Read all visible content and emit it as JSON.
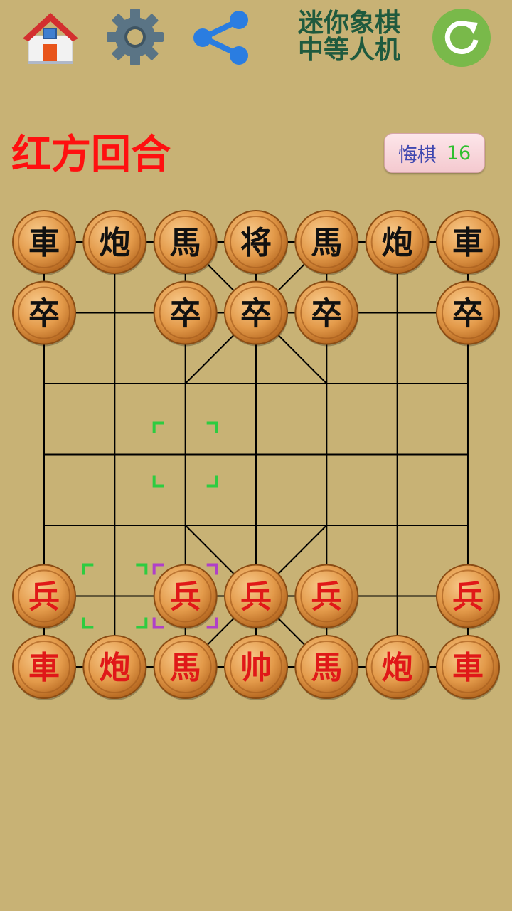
{
  "header": {
    "title_line1": "迷你象棋",
    "title_line2": "中等人机",
    "icons": {
      "home": "home-icon",
      "settings": "gear-icon",
      "share": "share-icon",
      "refresh": "refresh-icon"
    }
  },
  "status": {
    "turn_text": "红方回合"
  },
  "undo": {
    "label": "悔棋",
    "count": "16"
  },
  "board": {
    "columns": 7,
    "rows": 7,
    "colors": {
      "line": "#000000",
      "black_piece_text": "#111111",
      "red_piece_text": "#e01818",
      "piece_fill": "#e9a65a",
      "select_green": "#2ecc40",
      "select_purple": "#b040c8"
    },
    "pieces": [
      {
        "col": 0,
        "row": 0,
        "side": "black",
        "char": "車"
      },
      {
        "col": 1,
        "row": 0,
        "side": "black",
        "char": "炮"
      },
      {
        "col": 2,
        "row": 0,
        "side": "black",
        "char": "馬"
      },
      {
        "col": 3,
        "row": 0,
        "side": "black",
        "char": "将"
      },
      {
        "col": 4,
        "row": 0,
        "side": "black",
        "char": "馬"
      },
      {
        "col": 5,
        "row": 0,
        "side": "black",
        "char": "炮"
      },
      {
        "col": 6,
        "row": 0,
        "side": "black",
        "char": "車"
      },
      {
        "col": 0,
        "row": 1,
        "side": "black",
        "char": "卒"
      },
      {
        "col": 2,
        "row": 1,
        "side": "black",
        "char": "卒"
      },
      {
        "col": 3,
        "row": 1,
        "side": "black",
        "char": "卒"
      },
      {
        "col": 4,
        "row": 1,
        "side": "black",
        "char": "卒"
      },
      {
        "col": 6,
        "row": 1,
        "side": "black",
        "char": "卒"
      },
      {
        "col": 0,
        "row": 5,
        "side": "red",
        "char": "兵"
      },
      {
        "col": 2,
        "row": 5,
        "side": "red",
        "char": "兵"
      },
      {
        "col": 3,
        "row": 5,
        "side": "red",
        "char": "兵"
      },
      {
        "col": 4,
        "row": 5,
        "side": "red",
        "char": "兵"
      },
      {
        "col": 6,
        "row": 5,
        "side": "red",
        "char": "兵"
      },
      {
        "col": 0,
        "row": 6,
        "side": "red",
        "char": "車"
      },
      {
        "col": 1,
        "row": 6,
        "side": "red",
        "char": "炮"
      },
      {
        "col": 2,
        "row": 6,
        "side": "red",
        "char": "馬"
      },
      {
        "col": 3,
        "row": 6,
        "side": "red",
        "char": "帅"
      },
      {
        "col": 4,
        "row": 6,
        "side": "red",
        "char": "馬"
      },
      {
        "col": 5,
        "row": 6,
        "side": "red",
        "char": "炮"
      },
      {
        "col": 6,
        "row": 6,
        "side": "red",
        "char": "車"
      }
    ],
    "move_markers": [
      {
        "col": 2,
        "row": 3,
        "kind": "target"
      },
      {
        "col": 1,
        "row": 5,
        "kind": "target"
      },
      {
        "col": 2,
        "row": 5,
        "kind": "selected"
      }
    ]
  }
}
